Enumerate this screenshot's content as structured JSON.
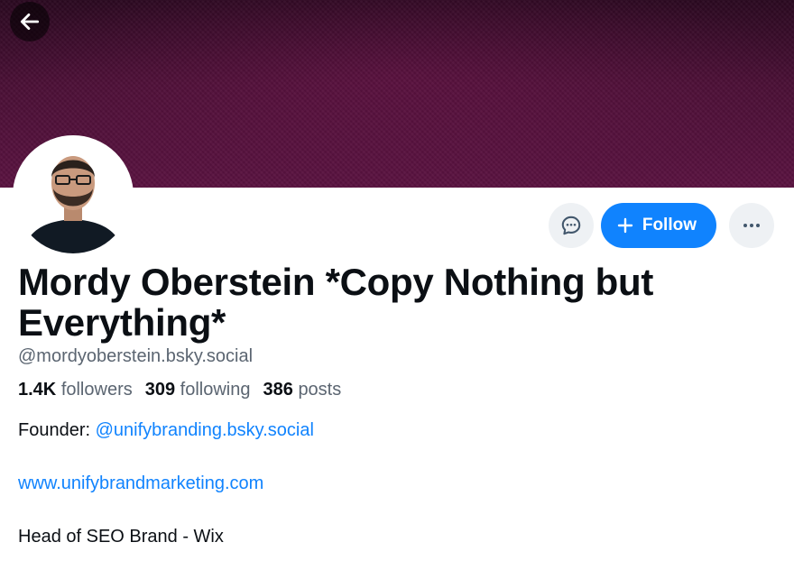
{
  "profile": {
    "display_name": "Mordy Oberstein *Copy Nothing but Everything*",
    "handle": "@mordyoberstein.bsky.social",
    "stats": {
      "followers_count": "1.4K",
      "followers_label": "followers",
      "following_count": "309",
      "following_label": "following",
      "posts_count": "386",
      "posts_label": "posts"
    },
    "bio": {
      "founder_prefix": "Founder: ",
      "founder_mention": "@unifybranding.bsky.social",
      "website": "www.unifybrandmarketing.com",
      "role": "Head of SEO Brand - Wix"
    }
  },
  "actions": {
    "follow_label": "Follow",
    "message_icon": "message-icon",
    "more_icon": "more-icon",
    "back_icon": "arrow-left-icon"
  },
  "colors": {
    "accent": "#1083fe",
    "banner": "#4a0f35",
    "muted_text": "#5b6571",
    "button_bg": "#eef1f4"
  }
}
